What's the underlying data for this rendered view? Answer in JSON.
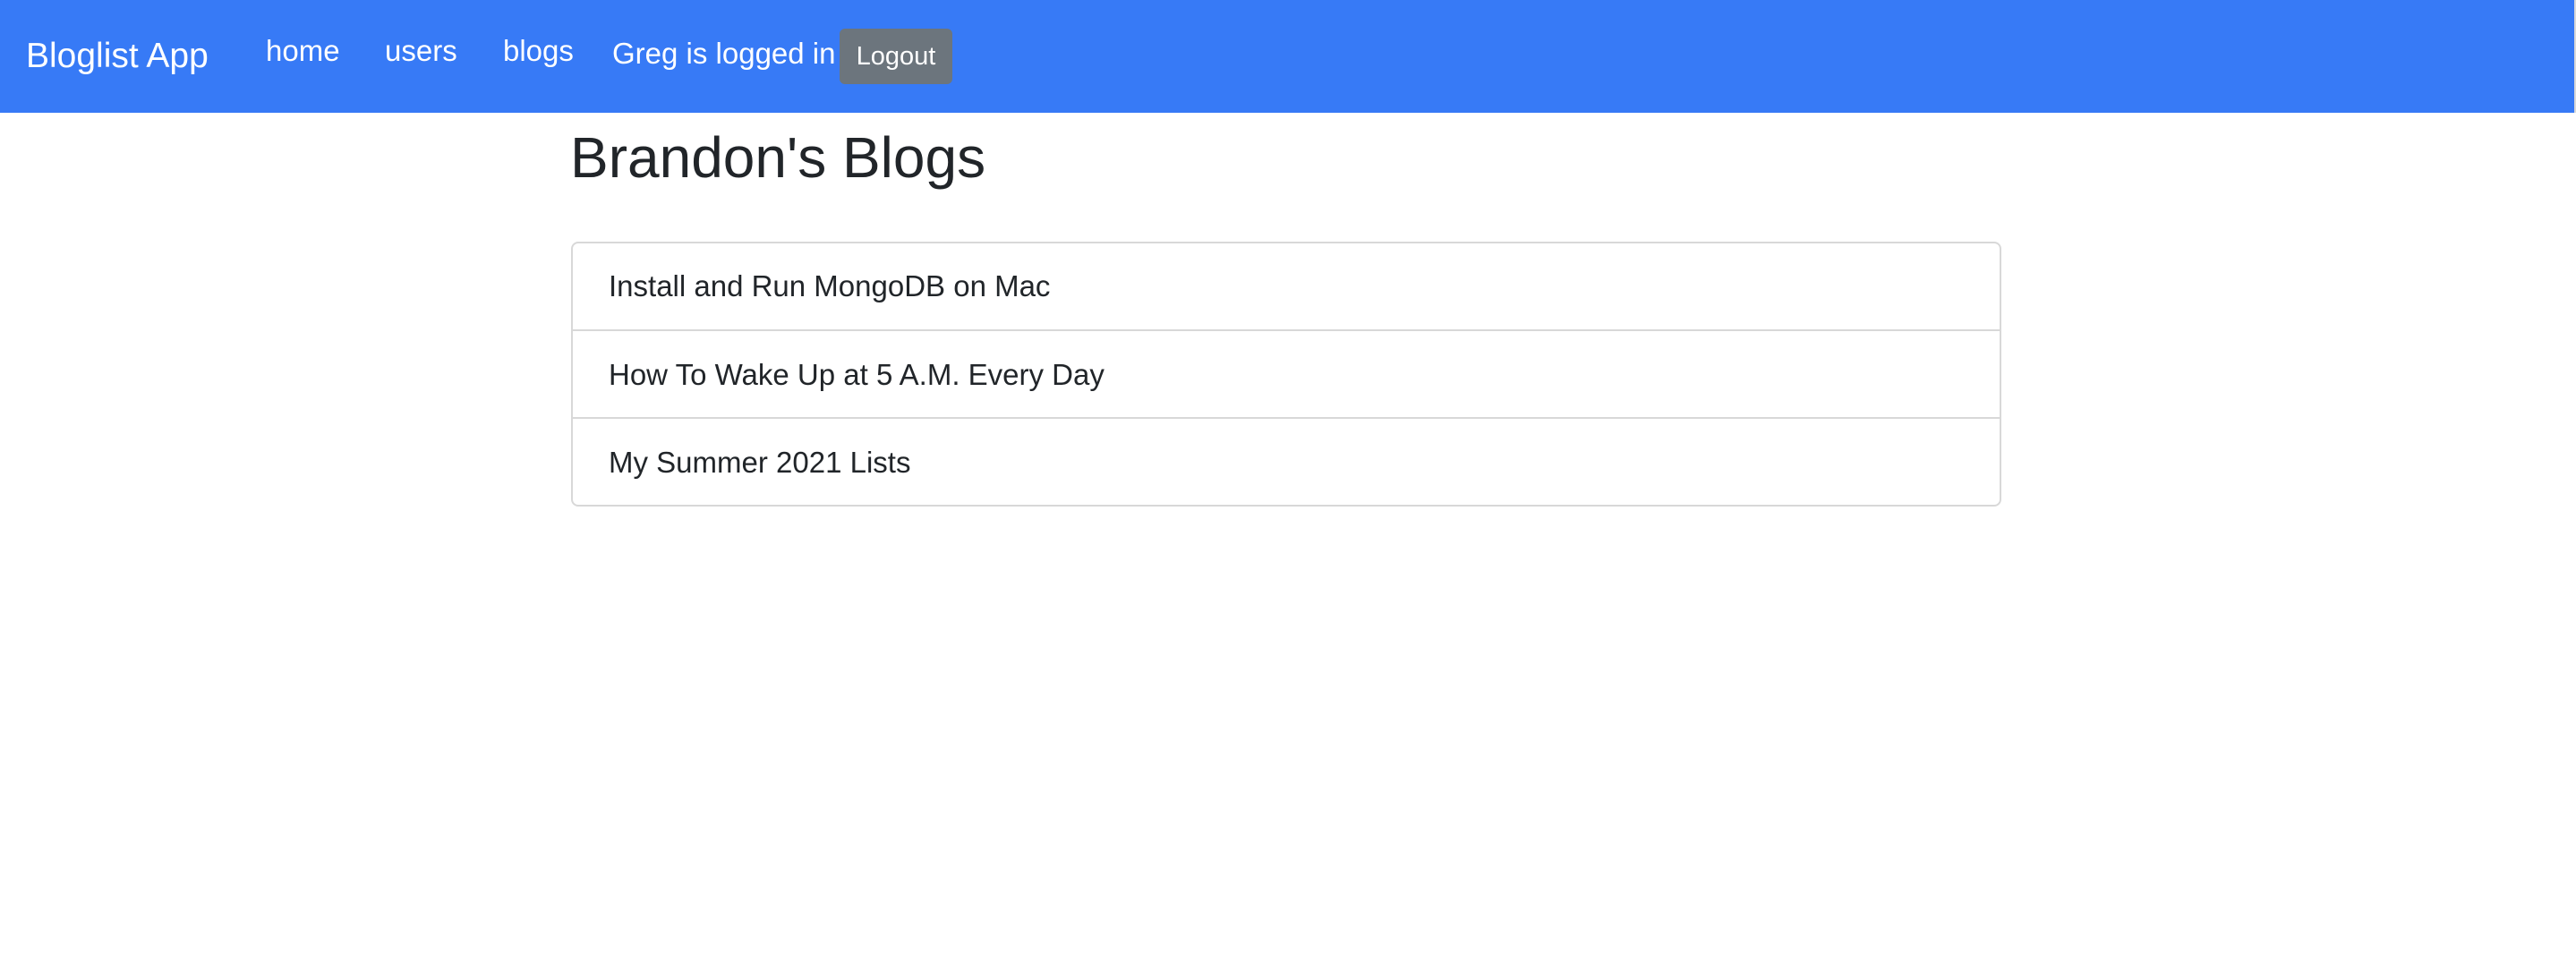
{
  "navbar": {
    "brand": "Bloglist App",
    "links": [
      {
        "label": "home"
      },
      {
        "label": "users"
      },
      {
        "label": "blogs"
      }
    ],
    "login_status": "Greg is logged in",
    "logout_label": "Logout",
    "background_color": "#377af6",
    "logout_color": "#6c757d"
  },
  "main": {
    "title": "Brandon's Blogs",
    "blogs": [
      {
        "title": "Install and Run MongoDB on Mac"
      },
      {
        "title": "How To Wake Up at 5 A.M. Every Day"
      },
      {
        "title": "My Summer 2021 Lists"
      }
    ]
  }
}
